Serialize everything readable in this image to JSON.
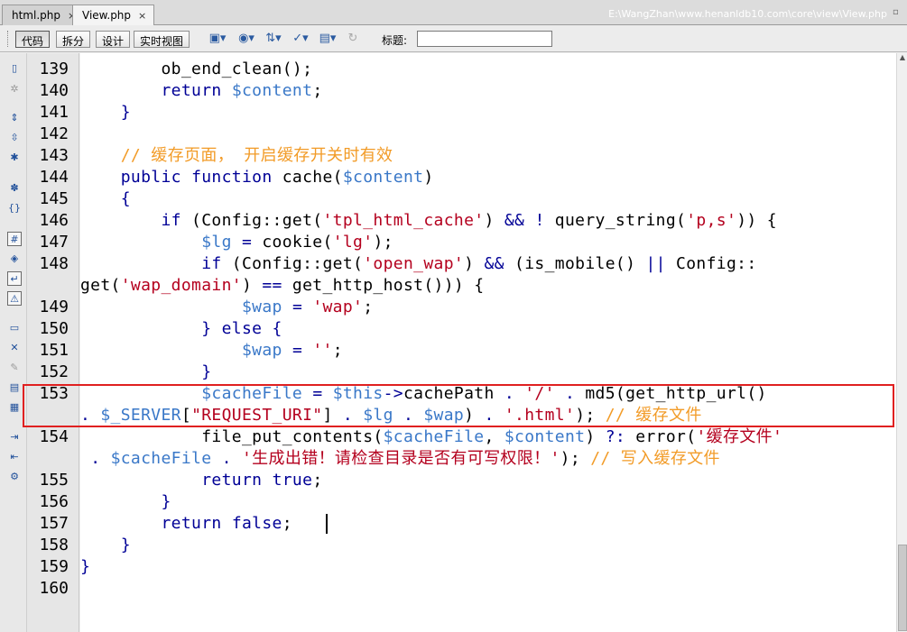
{
  "tabs": [
    {
      "label": "html.php",
      "close": "×"
    },
    {
      "label": "View.php",
      "close": "×"
    }
  ],
  "file_path": "E:\\WangZhan\\www.henanldb10.com\\core\\view\\View.php",
  "toolbar": {
    "code": "代码",
    "split": "拆分",
    "design": "设计",
    "live_view": "实时视图",
    "title_label": "标题:",
    "title_value": ""
  },
  "line_numbers": [
    "139",
    "140",
    "141",
    "142",
    "143",
    "144",
    "145",
    "146",
    "147",
    "148",
    "149",
    "150",
    "151",
    "152",
    "153",
    "154",
    "155",
    "156",
    "157",
    "158",
    "159",
    "160"
  ],
  "code": {
    "l139": {
      "i": "        ",
      "a": "ob_end_clean",
      "b": "();"
    },
    "l140": {
      "i": "        ",
      "a": "return",
      "b": " ",
      "c": "$content",
      "d": ";"
    },
    "l141": {
      "t": "    }"
    },
    "l143": {
      "i": "    ",
      "t": "// 缓存页面， 开启缓存开关时有效"
    },
    "l144": {
      "i": "    ",
      "a": "public",
      "b": " ",
      "c": "function",
      "d": " cache(",
      "e": "$content",
      "f": ")"
    },
    "l145": {
      "t": "    {"
    },
    "l146": {
      "i": "        ",
      "a": "if",
      "b": " (Config::get(",
      "c": "'tpl_html_cache'",
      "d": ") ",
      "e": "&&",
      "f": " ",
      "g": "!",
      "h": " query_string(",
      "j": "'p,s'",
      "k": ")) {"
    },
    "l147": {
      "i": "            ",
      "a": "$lg",
      "b": " ",
      "c": "=",
      "d": " cookie(",
      "e": "'lg'",
      "f": ");"
    },
    "l148a": {
      "i": "            ",
      "a": "if",
      "b": " (Config::get(",
      "c": "'open_wap'",
      "d": ") ",
      "e": "&&",
      "f": " (is_mobile() ",
      "g": "||",
      "h": " Config::"
    },
    "l148b": {
      "a": "get(",
      "b": "'wap_domain'",
      "c": ") ",
      "d": "==",
      "e": " get_http_host())) {"
    },
    "l149": {
      "i": "                ",
      "a": "$wap",
      "b": " ",
      "c": "=",
      "d": " ",
      "e": "'wap'",
      "f": ";"
    },
    "l150": {
      "i": "            ",
      "a": "} else {"
    },
    "l151": {
      "i": "                ",
      "a": "$wap",
      "b": " ",
      "c": "=",
      "d": " ",
      "e": "''",
      "f": ";"
    },
    "l152": {
      "t": "            }"
    },
    "l153a": {
      "i": "            ",
      "a": "$cacheFile",
      "b": " ",
      "c": "=",
      "d": " ",
      "e": "$this",
      "f": "->",
      "g": "cachePath ",
      "h": ".",
      "j": " ",
      "k": "'/'",
      "l": " ",
      "m": ".",
      "n": " md5(get_http_url()"
    },
    "l153b": {
      "a": ".",
      "b": " ",
      "c": "$_SERVER",
      "d": "[",
      "e": "\"REQUEST_URI\"",
      "f": "] ",
      "g": ".",
      "h": " ",
      "j": "$lg",
      "k": " ",
      "l": ".",
      "m": " ",
      "n": "$wap",
      "o": ") ",
      "p": ".",
      "q": " ",
      "r": "'.html'",
      "s": "); ",
      "t": "// 缓存文件"
    },
    "l154a": {
      "i": "            ",
      "a": "file_put_contents(",
      "b": "$cacheFile",
      "c": ", ",
      "d": "$content",
      "e": ") ",
      "f": "?:",
      "g": " error(",
      "h": "'缓存文件'"
    },
    "l154b": {
      "i": " ",
      "a": ".",
      "b": " ",
      "c": "$cacheFile",
      "d": " ",
      "e": ".",
      "f": " ",
      "g": "'生成出错！请检查目录是否有可写权限！'",
      "h": "); ",
      "j": "// 写入缓存文件"
    },
    "l155": {
      "i": "            ",
      "a": "return",
      "b": " ",
      "c": "true",
      "d": ";"
    },
    "l156": {
      "t": "        }"
    },
    "l157": {
      "i": "        ",
      "a": "return",
      "b": " ",
      "c": "false",
      "d": ";"
    },
    "l158": {
      "t": "    }"
    },
    "l159": {
      "t": "}"
    }
  }
}
